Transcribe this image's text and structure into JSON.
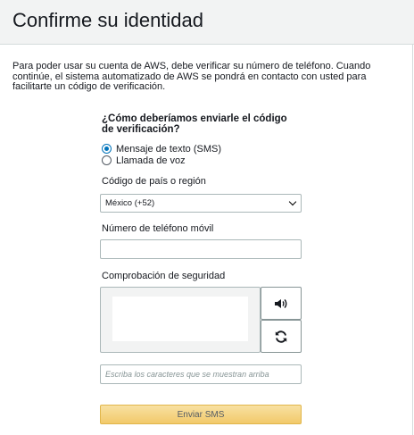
{
  "header": {
    "title": "Confirme su identidad"
  },
  "intro": "Para poder usar su cuenta de AWS, debe verificar su número de teléfono. Cuando continúe, el sistema automatizado de AWS se pondrá en contacto con usted para facilitarte un código de verificación.",
  "method": {
    "question": "¿Cómo deberíamos enviarle el código de verificación?",
    "options": [
      {
        "label": "Mensaje de texto (SMS)",
        "selected": true
      },
      {
        "label": "Llamada de voz",
        "selected": false
      }
    ]
  },
  "country": {
    "label": "Código de país o región",
    "value": "México (+52)"
  },
  "phone": {
    "label": "Número de teléfono móvil",
    "value": ""
  },
  "captcha": {
    "label": "Comprobación de seguridad",
    "audio_icon": "speaker-icon",
    "refresh_icon": "refresh-icon",
    "placeholder": "Escriba los caracteres que se muestran arriba"
  },
  "submit_label": "Enviar SMS",
  "colors": {
    "accent": "#0073bb",
    "button": "#f2c96a"
  }
}
